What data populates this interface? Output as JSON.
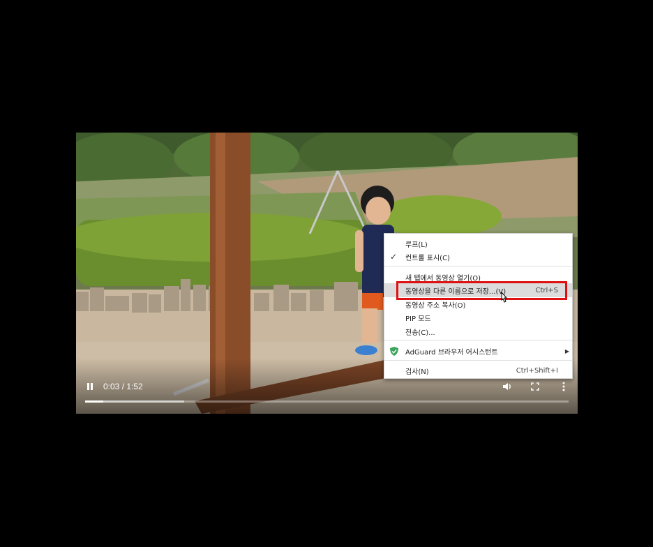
{
  "player": {
    "time_display": "0:03 / 1:52",
    "progress_fraction": 0.037,
    "buffer_fraction": 0.205
  },
  "context_menu": {
    "loop": "루프(L)",
    "show_controls": "컨트롤 표시(C)",
    "open_new_tab": "새 탭에서 동영상 열기(O)",
    "save_as": "동영상을 다른 이름으로 저장...(V)",
    "save_as_shortcut": "Ctrl+S",
    "copy_address": "동영상 주소 복사(O)",
    "pip": "PIP 모드",
    "cast": "전송(C)...",
    "adguard": "AdGuard 브라우저 어시스턴트",
    "inspect": "검사(N)",
    "inspect_shortcut": "Ctrl+Shift+I"
  },
  "icons": {
    "pause": "pause-icon",
    "volume": "volume-icon",
    "fullscreen": "fullscreen-icon",
    "more": "more-vert-icon",
    "check": "check-icon",
    "adguard": "adguard-shield-icon",
    "submenu": "submenu-arrow-icon",
    "cursor": "mouse-cursor-icon"
  },
  "colors": {
    "highlight_box": "#e01010",
    "menu_hover": "#dcdcdc",
    "adguard_green": "#3da35d"
  }
}
